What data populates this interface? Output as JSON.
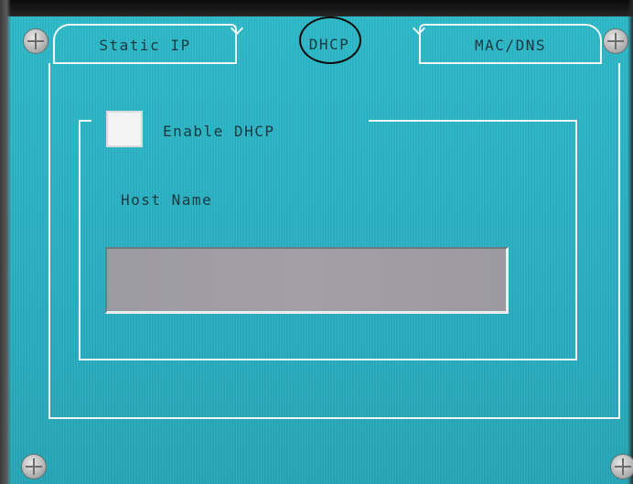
{
  "tabs": [
    {
      "label": "Static IP"
    },
    {
      "label": "DHCP"
    },
    {
      "label": "MAC/DNS"
    }
  ],
  "dhcp": {
    "enable_label": "Enable DHCP",
    "enable_checked": false,
    "host_name_label": "Host Name",
    "host_name_value": ""
  },
  "colors": {
    "screen": "#29b5c4",
    "outline": "#eef6f7",
    "input_fill": "#a09da5",
    "annotation_circle": "#0a0a0a"
  },
  "icons": [
    "screw-icon"
  ]
}
